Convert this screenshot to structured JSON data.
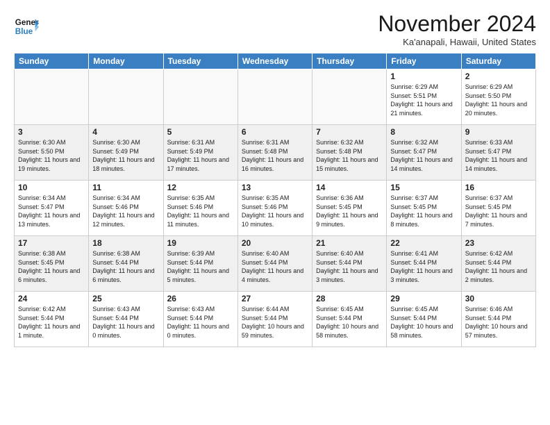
{
  "header": {
    "logo_line1": "General",
    "logo_line2": "Blue",
    "month_title": "November 2024",
    "location": "Ka'anapali, Hawaii, United States"
  },
  "weekdays": [
    "Sunday",
    "Monday",
    "Tuesday",
    "Wednesday",
    "Thursday",
    "Friday",
    "Saturday"
  ],
  "weeks": [
    [
      {
        "day": "",
        "info": ""
      },
      {
        "day": "",
        "info": ""
      },
      {
        "day": "",
        "info": ""
      },
      {
        "day": "",
        "info": ""
      },
      {
        "day": "",
        "info": ""
      },
      {
        "day": "1",
        "info": "Sunrise: 6:29 AM\nSunset: 5:51 PM\nDaylight: 11 hours\nand 21 minutes."
      },
      {
        "day": "2",
        "info": "Sunrise: 6:29 AM\nSunset: 5:50 PM\nDaylight: 11 hours\nand 20 minutes."
      }
    ],
    [
      {
        "day": "3",
        "info": "Sunrise: 6:30 AM\nSunset: 5:50 PM\nDaylight: 11 hours\nand 19 minutes."
      },
      {
        "day": "4",
        "info": "Sunrise: 6:30 AM\nSunset: 5:49 PM\nDaylight: 11 hours\nand 18 minutes."
      },
      {
        "day": "5",
        "info": "Sunrise: 6:31 AM\nSunset: 5:49 PM\nDaylight: 11 hours\nand 17 minutes."
      },
      {
        "day": "6",
        "info": "Sunrise: 6:31 AM\nSunset: 5:48 PM\nDaylight: 11 hours\nand 16 minutes."
      },
      {
        "day": "7",
        "info": "Sunrise: 6:32 AM\nSunset: 5:48 PM\nDaylight: 11 hours\nand 15 minutes."
      },
      {
        "day": "8",
        "info": "Sunrise: 6:32 AM\nSunset: 5:47 PM\nDaylight: 11 hours\nand 14 minutes."
      },
      {
        "day": "9",
        "info": "Sunrise: 6:33 AM\nSunset: 5:47 PM\nDaylight: 11 hours\nand 14 minutes."
      }
    ],
    [
      {
        "day": "10",
        "info": "Sunrise: 6:34 AM\nSunset: 5:47 PM\nDaylight: 11 hours\nand 13 minutes."
      },
      {
        "day": "11",
        "info": "Sunrise: 6:34 AM\nSunset: 5:46 PM\nDaylight: 11 hours\nand 12 minutes."
      },
      {
        "day": "12",
        "info": "Sunrise: 6:35 AM\nSunset: 5:46 PM\nDaylight: 11 hours\nand 11 minutes."
      },
      {
        "day": "13",
        "info": "Sunrise: 6:35 AM\nSunset: 5:46 PM\nDaylight: 11 hours\nand 10 minutes."
      },
      {
        "day": "14",
        "info": "Sunrise: 6:36 AM\nSunset: 5:45 PM\nDaylight: 11 hours\nand 9 minutes."
      },
      {
        "day": "15",
        "info": "Sunrise: 6:37 AM\nSunset: 5:45 PM\nDaylight: 11 hours\nand 8 minutes."
      },
      {
        "day": "16",
        "info": "Sunrise: 6:37 AM\nSunset: 5:45 PM\nDaylight: 11 hours\nand 7 minutes."
      }
    ],
    [
      {
        "day": "17",
        "info": "Sunrise: 6:38 AM\nSunset: 5:45 PM\nDaylight: 11 hours\nand 6 minutes."
      },
      {
        "day": "18",
        "info": "Sunrise: 6:38 AM\nSunset: 5:44 PM\nDaylight: 11 hours\nand 6 minutes."
      },
      {
        "day": "19",
        "info": "Sunrise: 6:39 AM\nSunset: 5:44 PM\nDaylight: 11 hours\nand 5 minutes."
      },
      {
        "day": "20",
        "info": "Sunrise: 6:40 AM\nSunset: 5:44 PM\nDaylight: 11 hours\nand 4 minutes."
      },
      {
        "day": "21",
        "info": "Sunrise: 6:40 AM\nSunset: 5:44 PM\nDaylight: 11 hours\nand 3 minutes."
      },
      {
        "day": "22",
        "info": "Sunrise: 6:41 AM\nSunset: 5:44 PM\nDaylight: 11 hours\nand 3 minutes."
      },
      {
        "day": "23",
        "info": "Sunrise: 6:42 AM\nSunset: 5:44 PM\nDaylight: 11 hours\nand 2 minutes."
      }
    ],
    [
      {
        "day": "24",
        "info": "Sunrise: 6:42 AM\nSunset: 5:44 PM\nDaylight: 11 hours\nand 1 minute."
      },
      {
        "day": "25",
        "info": "Sunrise: 6:43 AM\nSunset: 5:44 PM\nDaylight: 11 hours\nand 0 minutes."
      },
      {
        "day": "26",
        "info": "Sunrise: 6:43 AM\nSunset: 5:44 PM\nDaylight: 11 hours\nand 0 minutes."
      },
      {
        "day": "27",
        "info": "Sunrise: 6:44 AM\nSunset: 5:44 PM\nDaylight: 10 hours\nand 59 minutes."
      },
      {
        "day": "28",
        "info": "Sunrise: 6:45 AM\nSunset: 5:44 PM\nDaylight: 10 hours\nand 58 minutes."
      },
      {
        "day": "29",
        "info": "Sunrise: 6:45 AM\nSunset: 5:44 PM\nDaylight: 10 hours\nand 58 minutes."
      },
      {
        "day": "30",
        "info": "Sunrise: 6:46 AM\nSunset: 5:44 PM\nDaylight: 10 hours\nand 57 minutes."
      }
    ]
  ]
}
